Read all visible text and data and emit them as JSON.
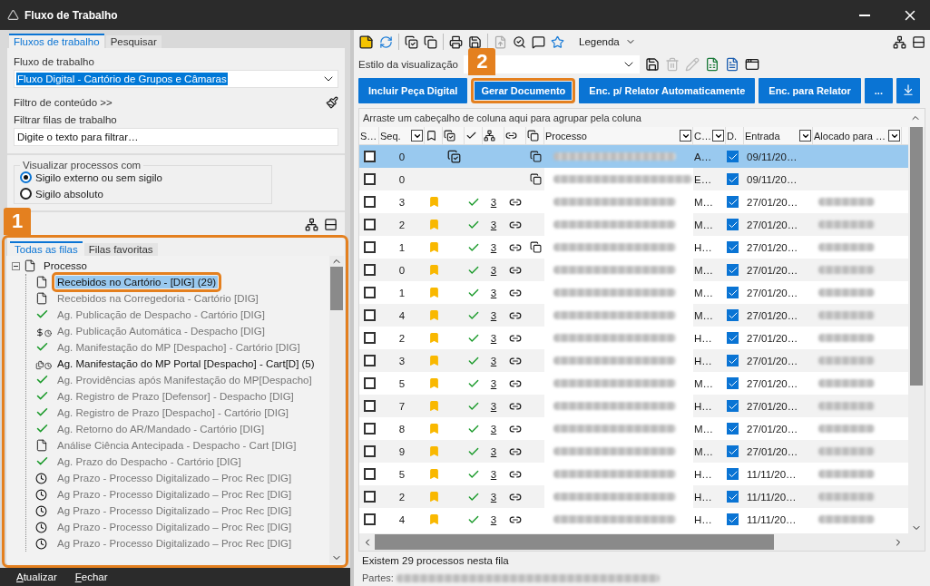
{
  "window": {
    "title": "Fluxo de Trabalho"
  },
  "left_panel": {
    "tabs": [
      {
        "label": "Fluxos de trabalho",
        "selected": true
      },
      {
        "label": "Pesquisar",
        "selected": false
      }
    ],
    "workflow": {
      "label": "Fluxo de trabalho",
      "value": "Fluxo Digital - Cartório de Grupos e Câmaras"
    },
    "content_filter": "Filtro de conteúdo >>",
    "queue_filter": {
      "label": "Filtrar filas de trabalho",
      "placeholder": "Digite o texto para filtrar…"
    },
    "visibility": {
      "legend": "Visualizar processos com",
      "options": [
        {
          "label": "Sigilo externo ou sem sigilo",
          "selected": true
        },
        {
          "label": "Sigilo absoluto",
          "selected": false
        }
      ]
    },
    "queue_section": {
      "highlighted": true,
      "tabs": [
        {
          "label": "Todas as filas",
          "selected": true
        },
        {
          "label": "Filas favoritas",
          "selected": false
        }
      ],
      "tree": {
        "label": "Processo",
        "expanded": true,
        "children": [
          {
            "label": "Recebidos no Cartório - [DIG] (29)",
            "kind": "doc",
            "selected": true,
            "emphasized": true
          },
          {
            "label": "Recebidos na Corregedoria - Cartório [DIG]",
            "kind": "doc",
            "selected": false,
            "emphasized": false
          },
          {
            "label": "Ag. Publicação de Despacho - Cartório [DIG]",
            "kind": "check",
            "selected": false,
            "emphasized": false
          },
          {
            "label": "Ag. Publicação Automática - Despacho [DIG]",
            "kind": "payment",
            "selected": false,
            "emphasized": false
          },
          {
            "label": "Ag. Manifestação do MP [Despacho] - Cartório [DIG]",
            "kind": "check",
            "selected": false,
            "emphasized": false
          },
          {
            "label": "Ag. Manifestação do MP Portal [Despacho] - Cart[D] (5)",
            "kind": "portal",
            "selected": false,
            "emphasized": true
          },
          {
            "label": "Ag. Providências após Manifestação do MP[Despacho]",
            "kind": "check",
            "selected": false,
            "emphasized": false
          },
          {
            "label": "Ag. Registro de Prazo [Defensor] - Despacho [DIG]",
            "kind": "check",
            "selected": false,
            "emphasized": false
          },
          {
            "label": "Ag. Registro de Prazo [Despacho] - Cartório [DIG]",
            "kind": "check",
            "selected": false,
            "emphasized": false
          },
          {
            "label": "Ag. Retorno do AR/Mandado - Cartório [DIG]",
            "kind": "check",
            "selected": false,
            "emphasized": false
          },
          {
            "label": "Análise Ciência Antecipada - Despacho - Cart [DIG]",
            "kind": "doc",
            "selected": false,
            "emphasized": false
          },
          {
            "label": "Ag. Prazo do Despacho - Cartório [DIG]",
            "kind": "check",
            "selected": false,
            "emphasized": false
          },
          {
            "label": "Ag Prazo - Processo Digitalizado – Proc Rec [DIG]",
            "kind": "timer",
            "selected": false,
            "emphasized": false
          },
          {
            "label": "Ag Prazo - Processo Digitalizado – Proc Rec [DIG]",
            "kind": "timer",
            "selected": false,
            "emphasized": false
          },
          {
            "label": "Ag Prazo - Processo Digitalizado – Proc Rec [DIG]",
            "kind": "timer",
            "selected": false,
            "emphasized": false
          },
          {
            "label": "Ag Prazo - Processo Digitalizado – Proc Rec [DIG]",
            "kind": "timer",
            "selected": false,
            "emphasized": false
          },
          {
            "label": "Ag Prazo - Processo Digitalizado – Proc Rec [DIG]",
            "kind": "timer",
            "selected": false,
            "emphasized": false
          }
        ]
      }
    },
    "actions": [
      "Atualizar",
      "Fechar"
    ]
  },
  "right_panel": {
    "toolbar": {
      "legend_label": "Legenda"
    },
    "view_style": {
      "label": "Estilo da visualização"
    },
    "buttons": [
      {
        "label": "Incluir Peça Digital",
        "highlighted": false
      },
      {
        "label": "Gerar Documento",
        "highlighted": true
      },
      {
        "label": "Enc. p/ Relator Automaticamente",
        "highlighted": false
      },
      {
        "label": "Enc. para Relator",
        "highlighted": false
      },
      {
        "label": "...",
        "highlighted": false
      }
    ],
    "grid": {
      "group_hint": "Arraste um cabeçalho de coluna aqui para agrupar pela coluna",
      "columns": [
        {
          "kind": "text",
          "label": "S…",
          "filter": false
        },
        {
          "kind": "text",
          "label": "Seq.",
          "filter": true
        },
        {
          "kind": "icon"
        },
        {
          "kind": "icon"
        },
        {
          "kind": "icon"
        },
        {
          "kind": "icon"
        },
        {
          "kind": "icon"
        },
        {
          "kind": "icon"
        },
        {
          "kind": "text",
          "label": "Processo",
          "filter": true
        },
        {
          "kind": "text",
          "label": "C…",
          "filter": true
        },
        {
          "kind": "text",
          "label": "D.",
          "filter": false
        },
        {
          "kind": "text",
          "label": "Entrada",
          "filter": true
        },
        {
          "kind": "text",
          "label": "Alocado para …",
          "filter": true
        }
      ],
      "rows": [
        {
          "selected": true,
          "checked": false,
          "seq": "0",
          "bookmarked": false,
          "signed": true,
          "approved": false,
          "linked": false,
          "copied": true,
          "c": "A…",
          "d_checked": true,
          "entrada": "09/11/20…",
          "allocated": false
        },
        {
          "selected": false,
          "checked": false,
          "seq": "0",
          "bookmarked": false,
          "signed": false,
          "approved": false,
          "linked": false,
          "copied": true,
          "c": "E…",
          "d_checked": true,
          "entrada": "09/11/20…",
          "allocated": false
        },
        {
          "selected": false,
          "checked": false,
          "seq": "3",
          "bookmarked": true,
          "signed": false,
          "approved": true,
          "count": "3",
          "linked": true,
          "copied": false,
          "c": "M…",
          "d_checked": true,
          "entrada": "27/01/20…",
          "allocated": true
        },
        {
          "selected": false,
          "checked": false,
          "seq": "2",
          "bookmarked": true,
          "signed": false,
          "approved": true,
          "count": "3",
          "linked": true,
          "copied": false,
          "c": "M…",
          "d_checked": true,
          "entrada": "27/01/20…",
          "allocated": true
        },
        {
          "selected": false,
          "checked": false,
          "seq": "1",
          "bookmarked": true,
          "signed": false,
          "approved": true,
          "count": "3",
          "linked": true,
          "copied": true,
          "c": "H…",
          "d_checked": true,
          "entrada": "27/01/20…",
          "allocated": true
        },
        {
          "selected": false,
          "checked": false,
          "seq": "0",
          "bookmarked": true,
          "signed": false,
          "approved": true,
          "count": "3",
          "linked": true,
          "copied": false,
          "c": "M…",
          "d_checked": true,
          "entrada": "27/01/20…",
          "allocated": true
        },
        {
          "selected": false,
          "checked": false,
          "seq": "1",
          "bookmarked": true,
          "signed": false,
          "approved": true,
          "count": "3",
          "linked": true,
          "copied": false,
          "c": "M…",
          "d_checked": true,
          "entrada": "27/01/20…",
          "allocated": true
        },
        {
          "selected": false,
          "checked": false,
          "seq": "4",
          "bookmarked": true,
          "signed": false,
          "approved": true,
          "count": "3",
          "linked": true,
          "copied": false,
          "c": "M…",
          "d_checked": true,
          "entrada": "27/01/20…",
          "allocated": true
        },
        {
          "selected": false,
          "checked": false,
          "seq": "2",
          "bookmarked": true,
          "signed": false,
          "approved": true,
          "count": "3",
          "linked": true,
          "copied": false,
          "c": "H…",
          "d_checked": true,
          "entrada": "27/01/20…",
          "allocated": true
        },
        {
          "selected": false,
          "checked": false,
          "seq": "3",
          "bookmarked": true,
          "signed": false,
          "approved": true,
          "count": "3",
          "linked": true,
          "copied": false,
          "c": "H…",
          "d_checked": true,
          "entrada": "27/01/20…",
          "allocated": true
        },
        {
          "selected": false,
          "checked": false,
          "seq": "5",
          "bookmarked": true,
          "signed": false,
          "approved": true,
          "count": "3",
          "linked": true,
          "copied": false,
          "c": "M…",
          "d_checked": true,
          "entrada": "27/01/20…",
          "allocated": true
        },
        {
          "selected": false,
          "checked": false,
          "seq": "7",
          "bookmarked": true,
          "signed": false,
          "approved": true,
          "count": "3",
          "linked": true,
          "copied": false,
          "c": "H…",
          "d_checked": true,
          "entrada": "27/01/20…",
          "allocated": true
        },
        {
          "selected": false,
          "checked": false,
          "seq": "8",
          "bookmarked": true,
          "signed": false,
          "approved": true,
          "count": "3",
          "linked": true,
          "copied": false,
          "c": "M…",
          "d_checked": true,
          "entrada": "27/01/20…",
          "allocated": true
        },
        {
          "selected": false,
          "checked": false,
          "seq": "9",
          "bookmarked": true,
          "signed": false,
          "approved": true,
          "count": "3",
          "linked": true,
          "copied": false,
          "c": "M…",
          "d_checked": true,
          "entrada": "27/01/20…",
          "allocated": true
        },
        {
          "selected": false,
          "checked": false,
          "seq": "5",
          "bookmarked": true,
          "signed": false,
          "approved": true,
          "count": "3",
          "linked": true,
          "copied": false,
          "c": "H…",
          "d_checked": true,
          "entrada": "11/11/20…",
          "allocated": true
        },
        {
          "selected": false,
          "checked": false,
          "seq": "2",
          "bookmarked": true,
          "signed": false,
          "approved": true,
          "count": "3",
          "linked": true,
          "copied": false,
          "c": "H…",
          "d_checked": true,
          "entrada": "11/11/20…",
          "allocated": true
        },
        {
          "selected": false,
          "checked": false,
          "seq": "4",
          "bookmarked": true,
          "signed": false,
          "approved": true,
          "count": "3",
          "linked": true,
          "copied": false,
          "c": "H…",
          "d_checked": true,
          "entrada": "11/11/20…",
          "allocated": true
        }
      ]
    },
    "status": "Existem 29 processos nesta fila",
    "parties_label": "Partes:"
  },
  "annotations": [
    {
      "number": "1"
    },
    {
      "number": "2"
    }
  ]
}
